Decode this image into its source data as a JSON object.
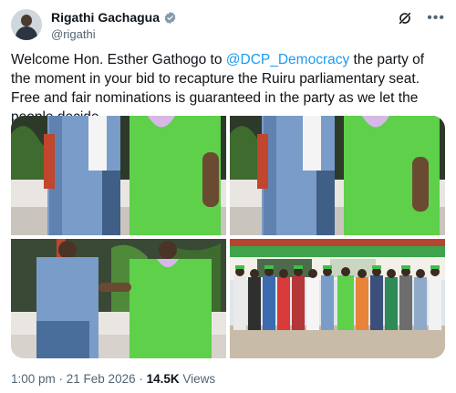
{
  "author": {
    "display_name": "Rigathi Gachagua",
    "handle": "@rigathi"
  },
  "tweet": {
    "text_before": "Welcome Hon. Esther Gathogo to ",
    "mention": "@DCP_Democracy",
    "text_after": " the party of the moment in your bid to recapture the Ruiru parliamentary seat. Free and fair nominations is guaranteed in the party as we let the people decide."
  },
  "meta": {
    "time": "1:00 pm",
    "separator": " · ",
    "date": "21 Feb 2026",
    "separator2": " · ",
    "views_count": "14.5K",
    "views_label": " Views"
  },
  "icons": {
    "verified": "verified-badge-icon",
    "grok": "grok-icon",
    "more": "more-icon"
  },
  "colors": {
    "accent": "#1d9bf0",
    "dress_green": "#5ed04a",
    "denim": "#6f93c0"
  }
}
